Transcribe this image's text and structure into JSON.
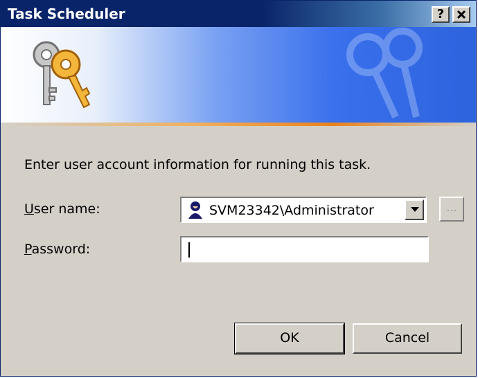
{
  "window": {
    "title": "Task Scheduler",
    "help_label": "?",
    "close_label": "✕"
  },
  "banner": {
    "icon": "keys-icon"
  },
  "dialog": {
    "instruction": "Enter user account information for running this task.",
    "username_label_mnemonic": "U",
    "username_label_rest": "ser name:",
    "username_value": "SVM23342\\Administrator",
    "password_label_mnemonic": "P",
    "password_label_rest": "assword:",
    "password_value": "",
    "browse_label": "..."
  },
  "buttons": {
    "ok": "OK",
    "cancel": "Cancel"
  }
}
